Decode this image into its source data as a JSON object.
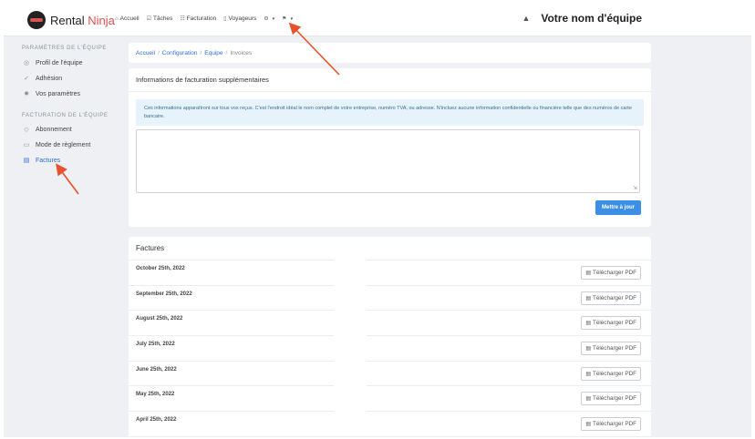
{
  "brand": {
    "name_part1": "Rental",
    "name_part2": "Ninja"
  },
  "nav": {
    "items": [
      {
        "icon": "home-icon",
        "label": "Accueil",
        "glyph": "⌂"
      },
      {
        "icon": "checkbox-icon",
        "label": "Tâches",
        "glyph": "☑"
      },
      {
        "icon": "invoice-icon",
        "label": "Facturation",
        "glyph": "☷"
      },
      {
        "icon": "travelers-icon",
        "label": "Voyageurs",
        "glyph": "▯"
      }
    ],
    "settings_glyph": "⚙",
    "flag_glyph": "⚑",
    "caret": "▾"
  },
  "team": {
    "bell_glyph": "▲",
    "name": "Votre nom d'équipe"
  },
  "sidebar": {
    "section1": "PARAMÈTRES DE L'ÉQUIPE",
    "items1": [
      {
        "label": "Profil de l'équipe",
        "glyph": "◎"
      },
      {
        "label": "Adhésion",
        "glyph": "✓"
      },
      {
        "label": "Vos paramètres",
        "glyph": "✹"
      }
    ],
    "section2": "FACTURATION DE L'ÉQUIPE",
    "items2": [
      {
        "label": "Abonnement",
        "glyph": "◇"
      },
      {
        "label": "Mode de règlement",
        "glyph": "▭"
      },
      {
        "label": "Factures",
        "glyph": "▤"
      }
    ]
  },
  "breadcrumb": {
    "home": "Accueil",
    "config": "Configuration",
    "team": "Equipe",
    "current": "Invoices"
  },
  "billing": {
    "title": "Informations de facturation supplémentaires",
    "info": "Ces informations apparaîtront sur tous vos reçus. C'est l'endroit idéal le nom complet de votre entreprise, numéro TVA, ou adresse. N'incluez aucune information confidentielle ou financière telle que des numéros de carte bancaire.",
    "textarea_value": "",
    "update_button": "Mettre à jour"
  },
  "invoices": {
    "title": "Factures",
    "download_label": "Télécharger PDF",
    "rows": [
      "October 25th, 2022",
      "September 25th, 2022",
      "August 25th, 2022",
      "July 25th, 2022",
      "June 25th, 2022",
      "May 25th, 2022",
      "April 25th, 2022"
    ]
  },
  "colors": {
    "accent": "#2f6fd6",
    "annotation_arrow": "#e8512a",
    "button": "#3b8fe6"
  }
}
